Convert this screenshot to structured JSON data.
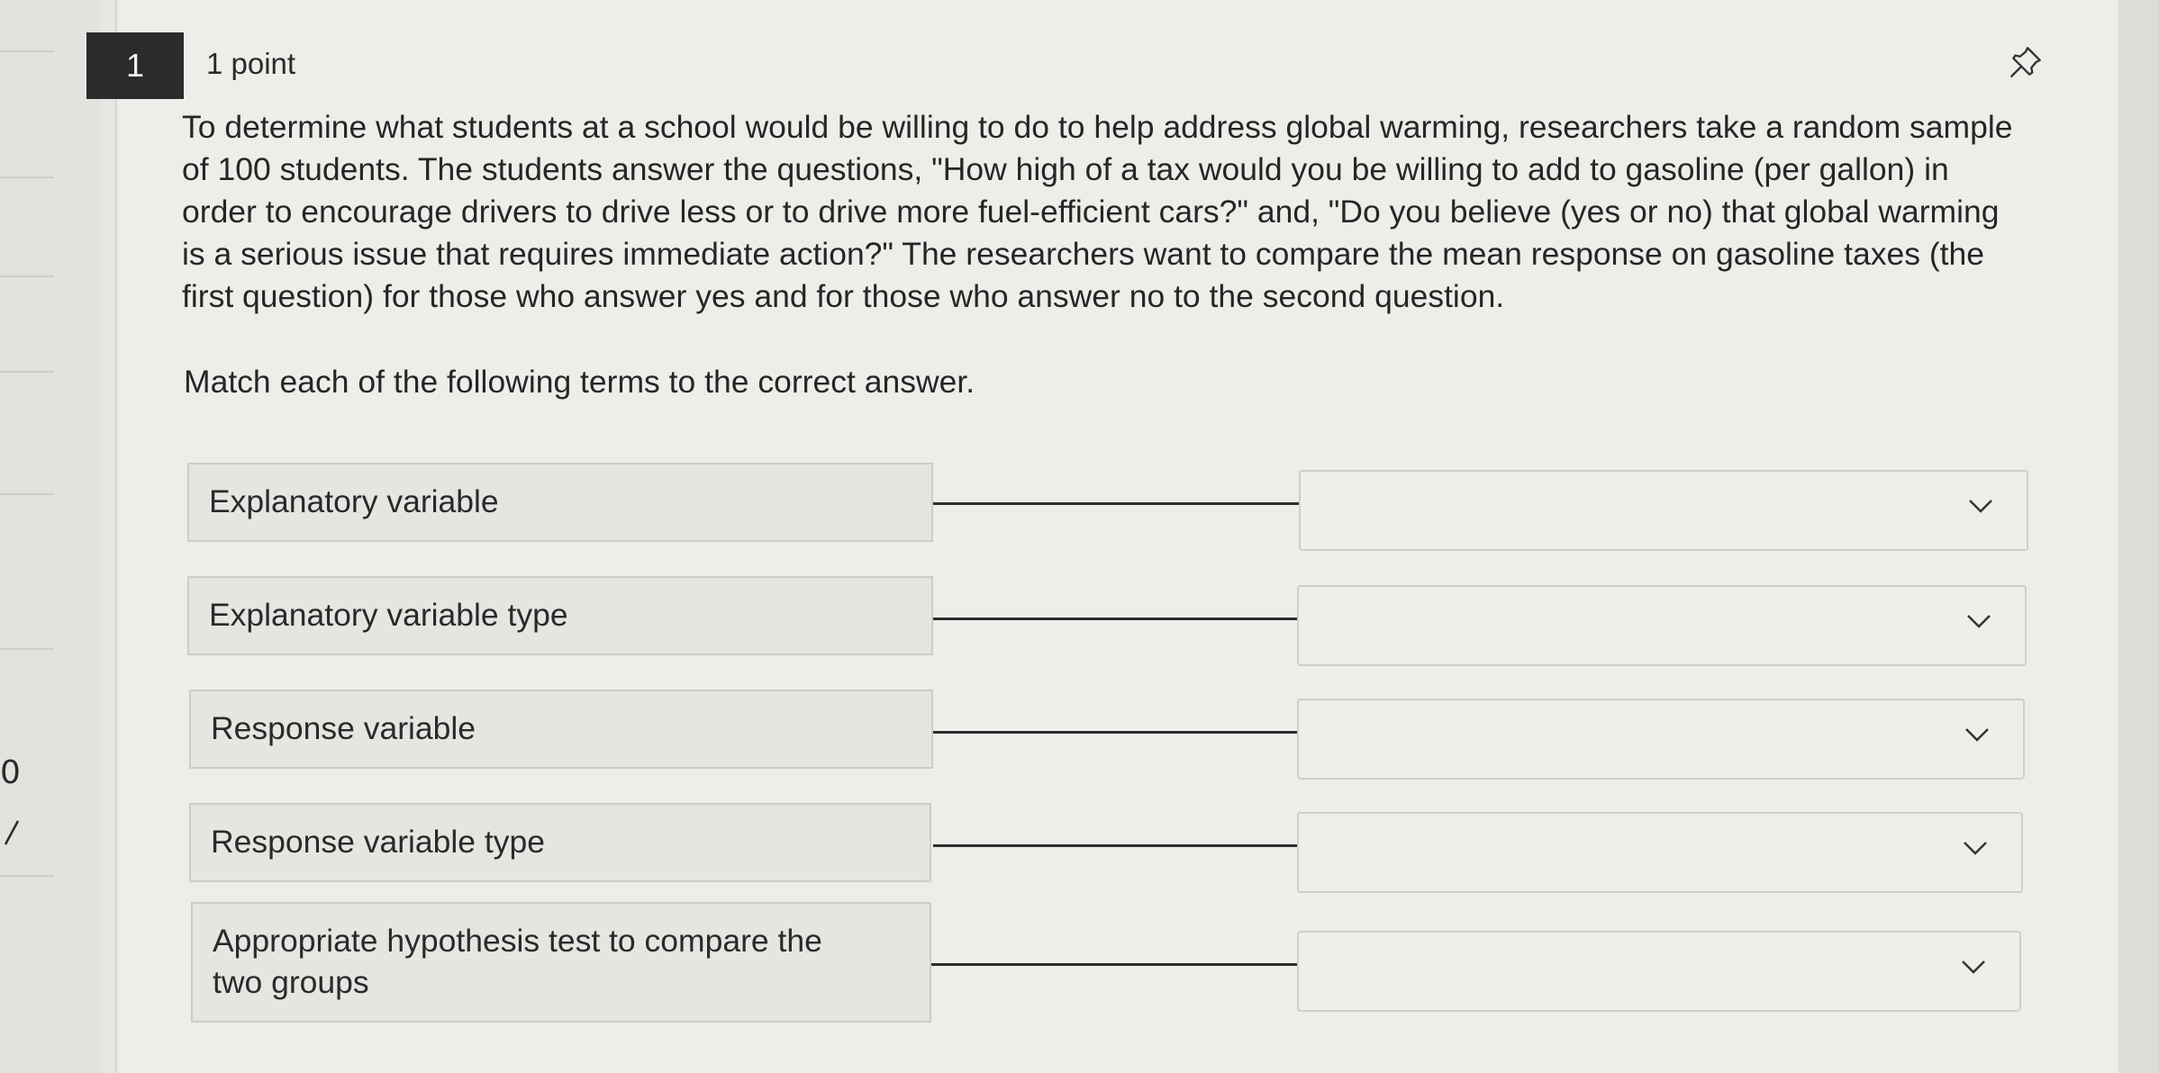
{
  "question": {
    "number": "1",
    "points": "1 point",
    "text": "To determine what students at a school would be willing to do to help address global warming, researchers take a random sample of 100 students. The students answer the questions, \"How high of a tax would you be willing to add to gasoline (per gallon) in order to encourage drivers to drive less or to drive more fuel-efficient cars?\" and, \"Do you believe (yes or no) that global warming is a serious issue that requires immediate action?\" The researchers want to compare the mean response on gasoline taxes (the first question) for those who answer yes and for those who answer no to the second question.",
    "instruction": "Match each of the following terms to the correct answer."
  },
  "matches": [
    {
      "term": "Explanatory variable",
      "selected": ""
    },
    {
      "term": "Explanatory variable type",
      "selected": ""
    },
    {
      "term": "Response variable",
      "selected": ""
    },
    {
      "term": "Response variable type",
      "selected": ""
    },
    {
      "term": "Appropriate hypothesis test to compare the two groups",
      "selected": ""
    }
  ],
  "icons": {
    "pin": "pin-icon",
    "dropdown": "chevron-down-icon"
  },
  "gutter": {
    "char": "0"
  }
}
